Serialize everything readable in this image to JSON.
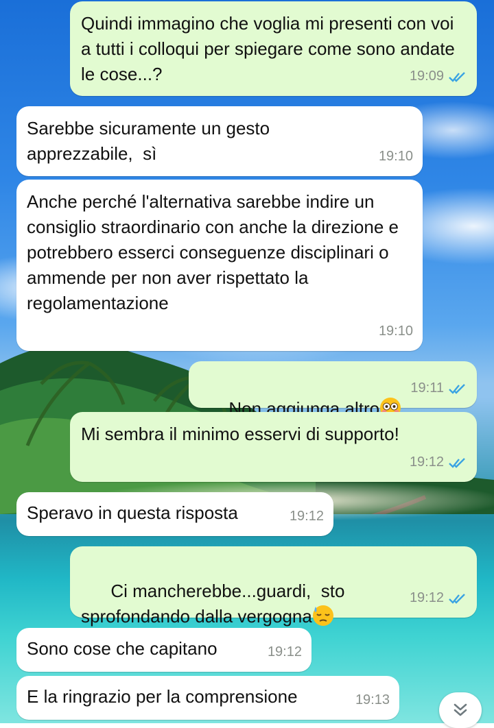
{
  "colors": {
    "outgoing_bubble": "#e2fbd1",
    "incoming_bubble": "#ffffff",
    "read_ticks": "#3aa3e3",
    "timestamp": "#8a8f8a"
  },
  "messages": [
    {
      "direction": "out",
      "text": "Quindi immagino che voglia mi presenti con voi a tutti i colloqui per spiegare come sono andate le cose...?",
      "time": "19:09",
      "status": "read"
    },
    {
      "direction": "in",
      "text": "Sarebbe sicuramente un gesto apprezzabile,  sì",
      "time": "19:10"
    },
    {
      "direction": "in",
      "text": "Anche perché l'alternativa sarebbe indire un consiglio straordinario con anche la direzione e potrebbero esserci conseguenze disciplinari o ammende per non aver rispettato la regolamentazione",
      "time": "19:10"
    },
    {
      "direction": "out",
      "text": "Non aggiunga altro",
      "emoji": "flushed-face",
      "time": "19:11",
      "status": "read"
    },
    {
      "direction": "out",
      "text": "Mi sembra il minimo esservi di supporto!",
      "time": "19:12",
      "status": "read"
    },
    {
      "direction": "in",
      "text": "Speravo in questa risposta",
      "time": "19:12"
    },
    {
      "direction": "out",
      "text": "Ci mancherebbe...guardi,  sto sprofondando dalla vergogna",
      "emoji": "downcast-face-with-sweat",
      "time": "19:12",
      "status": "read"
    },
    {
      "direction": "in",
      "text": "Sono cose che capitano",
      "time": "19:12"
    },
    {
      "direction": "in",
      "text": "E la ringrazio per la comprensione",
      "time": "19:13"
    }
  ],
  "scroll_button": {
    "icon": "double-chevron-down-icon"
  }
}
